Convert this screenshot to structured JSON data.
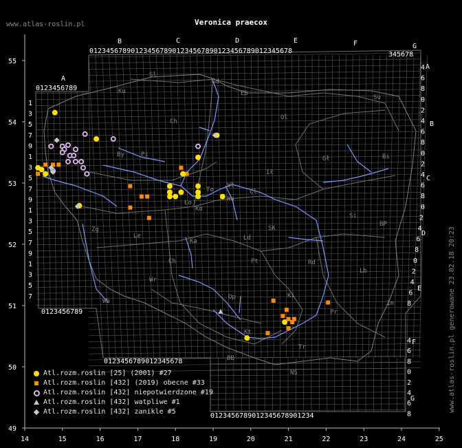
{
  "title": "Veronica praecox",
  "site_url": "www.atlas-roslin.pl",
  "side_text": "www.atlas-roslin.pl generowane 23.02.18 20:23",
  "axes": {
    "lon_labels": [
      "14",
      "15",
      "16",
      "17",
      "18",
      "19",
      "20",
      "21",
      "22",
      "23",
      "24",
      "25"
    ],
    "lat_labels": [
      "55",
      "54",
      "53",
      "52",
      "51",
      "50",
      "49"
    ]
  },
  "grid": {
    "column_letters": [
      "A",
      "B",
      "C",
      "D",
      "E",
      "F",
      "G"
    ],
    "row_letters": [
      "A",
      "B",
      "C",
      "D",
      "E",
      "F",
      "G"
    ],
    "top_digits_main": "0123456789012345678901234567890123456789012345678901234567890123456789",
    "top_digits_g": "345678",
    "top_digits_a": "0123456789",
    "bottom_digits_a": "0123456789",
    "bottom_digits_mid": "0123456789012345678",
    "bottom_digits_right": "0123456789012345678901234",
    "left_digits_a": [
      "1",
      "3",
      "5",
      "7",
      "9",
      "1",
      "3",
      "5",
      "7",
      "9",
      "1",
      "3",
      "5",
      "7",
      "9",
      "1",
      "3",
      "5",
      "7"
    ],
    "right_digits": [
      "4",
      "6",
      "8",
      "0",
      "2",
      "4",
      "6",
      "8",
      "0",
      "2",
      "4",
      "6",
      "8",
      "0",
      "2",
      "4",
      "6",
      "8",
      "0",
      "2",
      "4",
      "6",
      "8"
    ],
    "right_digits_lower": [
      "4",
      "6",
      "8",
      "0",
      "2",
      "4",
      "6",
      "8"
    ],
    "region_codes": [
      "Sl",
      "Gd",
      "Eb",
      "Su",
      "Ku",
      "Ch",
      "Ol",
      "Pi",
      "Ił",
      "Bi",
      "Gł",
      "Wł",
      "Cl",
      "To",
      "By",
      "Wa",
      "Ło",
      "Ko",
      "SK",
      "Si",
      "BP",
      "Zg",
      "Le",
      "Ka",
      "Ld",
      "Pt",
      "Rd",
      "Lb",
      "Wr",
      "Ch",
      "Op",
      "Ki",
      "Wb",
      "Zm",
      "Kt",
      "Tr",
      "Pr",
      "BB",
      "NS"
    ]
  },
  "colors": {
    "background": "#000000",
    "grid_line": "#5a5a5a",
    "border_line": "#6e6e6e",
    "river": "#7f98ff",
    "yellow": "#ffe000",
    "orange": "#ff8c00",
    "purple_ring": "#d8b4e8",
    "gray_diamond": "#c8c8c8"
  },
  "legend": [
    {
      "symbol": "yellow-circle-icon",
      "label": "Atl.rozm.roslin [25] (2001) #27"
    },
    {
      "symbol": "orange-square-icon",
      "label": "Atl.rozm.roslin [432] (2019) obecne #33"
    },
    {
      "symbol": "purple-ring-icon",
      "label": "Atl.rozm.roslin [432] niepotwierdzone #19"
    },
    {
      "symbol": "gray-triangle-icon",
      "label": "Atl.rozm.roslin [432] watpliwe #1"
    },
    {
      "symbol": "gray-diamond-icon",
      "label": "Atl.rozm.roslin [432] zanikle #5"
    }
  ],
  "records": {
    "yellow_circles": [
      [
        14.45,
        53.22
      ],
      [
        14.55,
        53.15
      ],
      [
        14.8,
        54.15
      ],
      [
        15.9,
        53.72
      ],
      [
        15.45,
        52.63
      ],
      [
        18.6,
        53.42
      ],
      [
        19.1,
        53.78
      ],
      [
        18.2,
        53.15
      ],
      [
        17.85,
        52.95
      ],
      [
        17.85,
        52.85
      ],
      [
        17.85,
        52.78
      ],
      [
        18,
        52.78
      ],
      [
        18.15,
        52.85
      ],
      [
        18.6,
        52.95
      ],
      [
        18.6,
        52.85
      ],
      [
        18.6,
        52.78
      ],
      [
        19.25,
        52.78
      ],
      [
        19.9,
        50.47
      ],
      [
        20.9,
        50.73
      ],
      [
        14.35,
        53.25
      ]
    ],
    "orange_squares": [
      [
        14.55,
        53.3
      ],
      [
        14.75,
        53.3
      ],
      [
        14.9,
        53.3
      ],
      [
        14.35,
        53.15
      ],
      [
        18.15,
        53.25
      ],
      [
        18.3,
        53.15
      ],
      [
        16.8,
        52.95
      ],
      [
        16.8,
        52.6
      ],
      [
        17.1,
        52.78
      ],
      [
        17.25,
        52.78
      ],
      [
        17.3,
        52.43
      ],
      [
        20.6,
        51.08
      ],
      [
        22.05,
        51.05
      ],
      [
        20.85,
        50.83
      ],
      [
        20.95,
        50.93
      ],
      [
        21,
        50.78
      ],
      [
        21.1,
        50.73
      ],
      [
        21.15,
        50.78
      ],
      [
        21,
        50.63
      ],
      [
        20.45,
        50.55
      ]
    ],
    "purple_rings": [
      [
        14.7,
        53.6
      ],
      [
        15,
        53.6
      ],
      [
        15.15,
        53.62
      ],
      [
        15.05,
        53.55
      ],
      [
        15.2,
        53.45
      ],
      [
        15.35,
        53.55
      ],
      [
        15.3,
        53.45
      ],
      [
        15.15,
        53.35
      ],
      [
        15.35,
        53.35
      ],
      [
        15.5,
        53.35
      ],
      [
        15.55,
        53.25
      ],
      [
        15.65,
        53.15
      ],
      [
        15.6,
        53.8
      ],
      [
        16.35,
        53.72
      ],
      [
        18.6,
        53.6
      ],
      [
        14.75,
        53.2
      ],
      [
        15,
        53.5
      ]
    ],
    "gray_diamonds": [
      [
        14.85,
        53.7
      ],
      [
        14.7,
        53.25
      ],
      [
        15.4,
        52.62
      ],
      [
        19.05,
        53.78
      ],
      [
        14.75,
        53.18
      ]
    ],
    "gray_triangles": [
      [
        19.2,
        50.9
      ]
    ]
  }
}
